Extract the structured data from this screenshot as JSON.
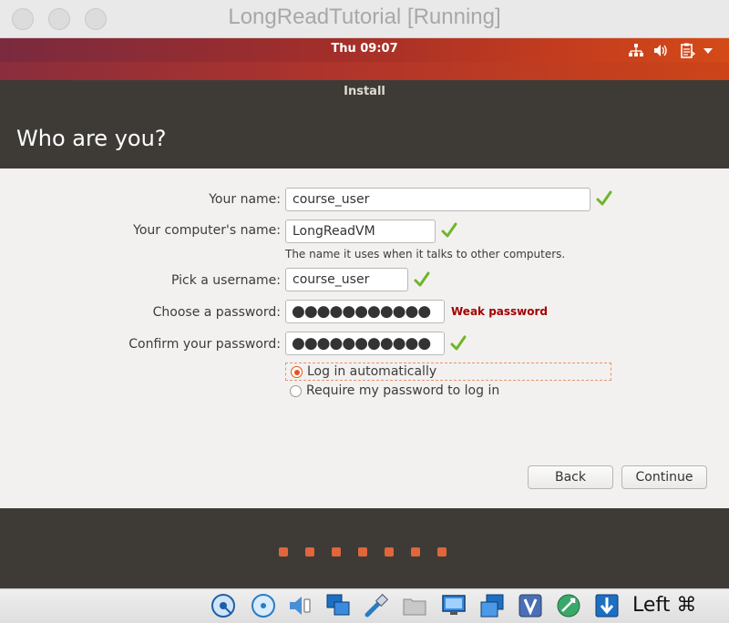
{
  "window": {
    "title": "LongReadTutorial [Running]"
  },
  "panel": {
    "clock": "Thu 09:07"
  },
  "installer": {
    "title": "Install",
    "heading": "Who are you?"
  },
  "form": {
    "name_label": "Your name:",
    "name_value": "course_user",
    "computer_label": "Your computer's name:",
    "computer_value": "LongReadVM",
    "computer_hint": "The name it uses when it talks to other computers.",
    "username_label": "Pick a username:",
    "username_value": "course_user",
    "password_label": "Choose a password:",
    "password_value": "●●●●●●●●●●●",
    "password_strength": "Weak password",
    "confirm_label": "Confirm your password:",
    "confirm_value": "●●●●●●●●●●●",
    "login_options": {
      "auto": "Log in automatically",
      "require": "Require my password to log in",
      "selected": "auto"
    }
  },
  "buttons": {
    "back": "Back",
    "continue": "Continue"
  },
  "slideshow": {
    "total": 7
  },
  "statusbar": {
    "host_key": "Left ⌘"
  },
  "colors": {
    "accent": "#e9541d",
    "check": "#6fb52c",
    "warning": "#a40000",
    "header": "#3e3b37"
  }
}
